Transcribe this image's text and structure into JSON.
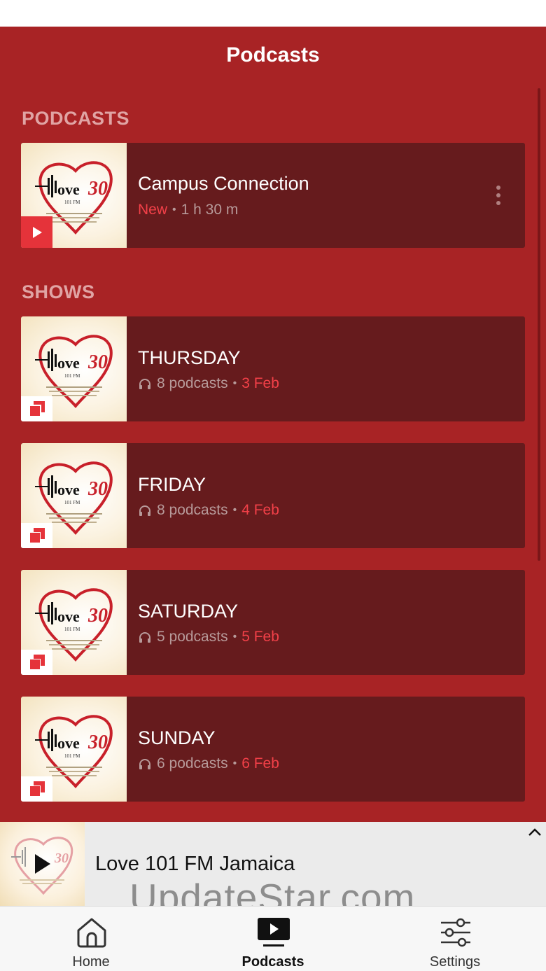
{
  "header": {
    "title": "Podcasts"
  },
  "sections": {
    "podcasts": "PODCASTS",
    "shows": "SHOWS"
  },
  "podcasts": [
    {
      "title": "Campus Connection",
      "status": "New",
      "separator": "•",
      "duration": "1 h 30 m"
    }
  ],
  "shows": [
    {
      "title": "THURSDAY",
      "count": "8 podcasts",
      "separator": "•",
      "date": "3 Feb"
    },
    {
      "title": "FRIDAY",
      "count": "8 podcasts",
      "separator": "•",
      "date": "4 Feb"
    },
    {
      "title": "SATURDAY",
      "count": "5 podcasts",
      "separator": "•",
      "date": "5 Feb"
    },
    {
      "title": "SUNDAY",
      "count": "6 podcasts",
      "separator": "•",
      "date": "6 Feb"
    }
  ],
  "now_playing": {
    "title": "Love 101 FM Jamaica"
  },
  "watermark": "UpdateStar.com",
  "tabs": [
    {
      "label": "Home",
      "icon": "home-icon"
    },
    {
      "label": "Podcasts",
      "icon": "podcasts-icon",
      "active": true
    },
    {
      "label": "Settings",
      "icon": "sliders-icon"
    }
  ],
  "artwork": {
    "logo_text": "Love 101 FM"
  },
  "colors": {
    "background": "#A82325",
    "card": "#661B1D",
    "accent": "#F24048",
    "section_heading": "#E0A4A4"
  }
}
